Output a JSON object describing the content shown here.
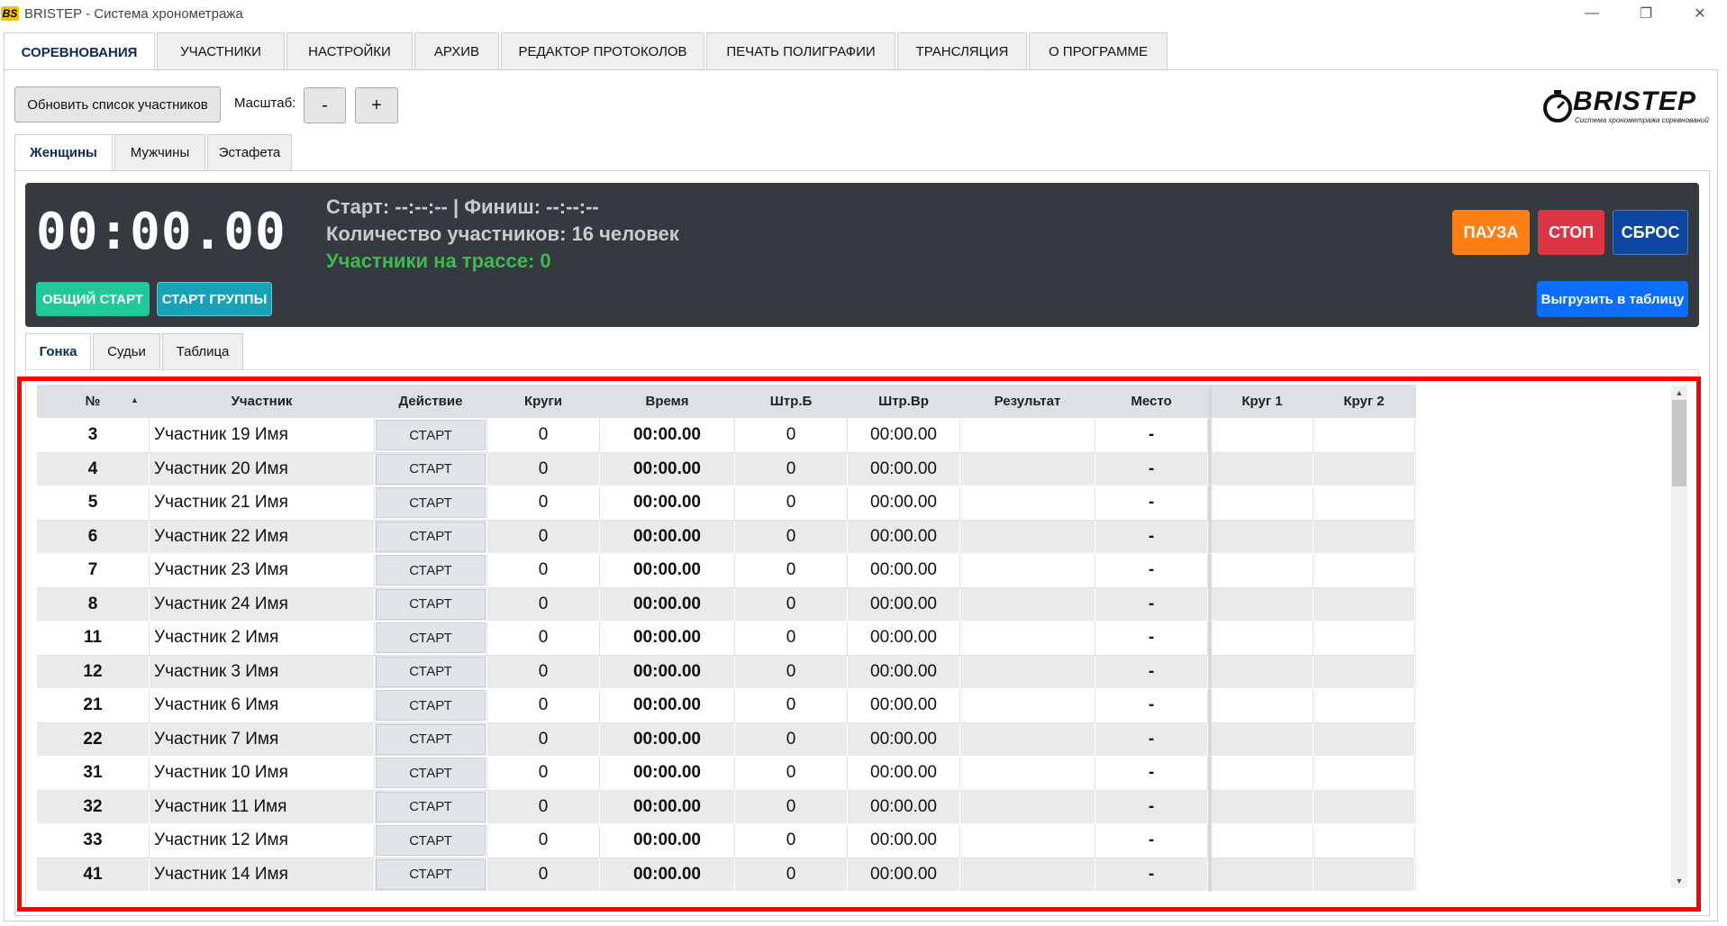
{
  "window": {
    "icon_text": "BS",
    "title": "BRISTEP - Система хронометража"
  },
  "top_tabs": [
    {
      "label": "СОРЕВНОВАНИЯ",
      "active": true
    },
    {
      "label": "УЧАСТНИКИ",
      "active": false
    },
    {
      "label": "НАСТРОЙКИ",
      "active": false
    },
    {
      "label": "АРХИВ",
      "active": false
    },
    {
      "label": "РЕДАКТОР ПРОТОКОЛОВ",
      "active": false
    },
    {
      "label": "ПЕЧАТЬ ПОЛИГРАФИИ",
      "active": false
    },
    {
      "label": "ТРАНСЛЯЦИЯ",
      "active": false
    },
    {
      "label": "О ПРОГРАММЕ",
      "active": false
    }
  ],
  "toolbar": {
    "refresh_label": "Обновить список участников",
    "scale_label": "Масштаб:",
    "minus_label": "-",
    "plus_label": "+"
  },
  "logo": {
    "text": "BRISTEP",
    "subtitle": "Система хронометража соревнований"
  },
  "group_tabs": [
    {
      "label": "Женщины",
      "active": true
    },
    {
      "label": "Мужчины",
      "active": false
    },
    {
      "label": "Эстафета",
      "active": false
    }
  ],
  "timer_panel": {
    "time": "00:00.00",
    "start_finish": "Старт: --:--:-- | Финиш: --:--:--",
    "participants_count": "Количество участников: 16 человек",
    "on_track": "Участники на трассе: 0",
    "general_start_label": "ОБЩИЙ СТАРТ",
    "group_start_label": "СТАРТ ГРУППЫ",
    "pause_label": "ПАУЗА",
    "stop_label": "СТОП",
    "reset_label": "СБРОС",
    "export_label": "Выгрузить в таблицу",
    "colors": {
      "panel": "#343a40",
      "general_start": "#20c997",
      "group_start": "#17a2b8",
      "pause": "#fd7e14",
      "stop": "#dc3545",
      "reset": "#0d47a1",
      "export": "#0d6efd",
      "on_track_text": "#3fb950"
    }
  },
  "race_tabs": [
    {
      "label": "Гонка",
      "active": true
    },
    {
      "label": "Судьи",
      "active": false
    },
    {
      "label": "Таблица",
      "active": false
    }
  ],
  "grid": {
    "sort_indicator": "▲",
    "columns": [
      "№",
      "Участник",
      "Действие",
      "Круги",
      "Время",
      "Штр.Б",
      "Штр.Вр",
      "Результат",
      "Место",
      "Круг 1",
      "Круг 2"
    ],
    "rows": [
      {
        "num": "3",
        "name": "Участник 19 Имя",
        "action": "СТАРТ",
        "laps": "0",
        "time": "00:00.00",
        "penalty": "0",
        "penalty_time": "00:00.00",
        "result": "",
        "place": "-",
        "lap1": "",
        "lap2": ""
      },
      {
        "num": "4",
        "name": "Участник 20 Имя",
        "action": "СТАРТ",
        "laps": "0",
        "time": "00:00.00",
        "penalty": "0",
        "penalty_time": "00:00.00",
        "result": "",
        "place": "-",
        "lap1": "",
        "lap2": ""
      },
      {
        "num": "5",
        "name": "Участник 21 Имя",
        "action": "СТАРТ",
        "laps": "0",
        "time": "00:00.00",
        "penalty": "0",
        "penalty_time": "00:00.00",
        "result": "",
        "place": "-",
        "lap1": "",
        "lap2": ""
      },
      {
        "num": "6",
        "name": "Участник 22 Имя",
        "action": "СТАРТ",
        "laps": "0",
        "time": "00:00.00",
        "penalty": "0",
        "penalty_time": "00:00.00",
        "result": "",
        "place": "-",
        "lap1": "",
        "lap2": ""
      },
      {
        "num": "7",
        "name": "Участник 23 Имя",
        "action": "СТАРТ",
        "laps": "0",
        "time": "00:00.00",
        "penalty": "0",
        "penalty_time": "00:00.00",
        "result": "",
        "place": "-",
        "lap1": "",
        "lap2": ""
      },
      {
        "num": "8",
        "name": "Участник 24 Имя",
        "action": "СТАРТ",
        "laps": "0",
        "time": "00:00.00",
        "penalty": "0",
        "penalty_time": "00:00.00",
        "result": "",
        "place": "-",
        "lap1": "",
        "lap2": ""
      },
      {
        "num": "11",
        "name": "Участник 2 Имя",
        "action": "СТАРТ",
        "laps": "0",
        "time": "00:00.00",
        "penalty": "0",
        "penalty_time": "00:00.00",
        "result": "",
        "place": "-",
        "lap1": "",
        "lap2": ""
      },
      {
        "num": "12",
        "name": "Участник 3 Имя",
        "action": "СТАРТ",
        "laps": "0",
        "time": "00:00.00",
        "penalty": "0",
        "penalty_time": "00:00.00",
        "result": "",
        "place": "-",
        "lap1": "",
        "lap2": ""
      },
      {
        "num": "21",
        "name": "Участник 6 Имя",
        "action": "СТАРТ",
        "laps": "0",
        "time": "00:00.00",
        "penalty": "0",
        "penalty_time": "00:00.00",
        "result": "",
        "place": "-",
        "lap1": "",
        "lap2": ""
      },
      {
        "num": "22",
        "name": "Участник 7 Имя",
        "action": "СТАРТ",
        "laps": "0",
        "time": "00:00.00",
        "penalty": "0",
        "penalty_time": "00:00.00",
        "result": "",
        "place": "-",
        "lap1": "",
        "lap2": ""
      },
      {
        "num": "31",
        "name": "Участник 10 Имя",
        "action": "СТАРТ",
        "laps": "0",
        "time": "00:00.00",
        "penalty": "0",
        "penalty_time": "00:00.00",
        "result": "",
        "place": "-",
        "lap1": "",
        "lap2": ""
      },
      {
        "num": "32",
        "name": "Участник 11 Имя",
        "action": "СТАРТ",
        "laps": "0",
        "time": "00:00.00",
        "penalty": "0",
        "penalty_time": "00:00.00",
        "result": "",
        "place": "-",
        "lap1": "",
        "lap2": ""
      },
      {
        "num": "33",
        "name": "Участник 12 Имя",
        "action": "СТАРТ",
        "laps": "0",
        "time": "00:00.00",
        "penalty": "0",
        "penalty_time": "00:00.00",
        "result": "",
        "place": "-",
        "lap1": "",
        "lap2": ""
      },
      {
        "num": "41",
        "name": "Участник 14 Имя",
        "action": "СТАРТ",
        "laps": "0",
        "time": "00:00.00",
        "penalty": "0",
        "penalty_time": "00:00.00",
        "result": "",
        "place": "-",
        "lap1": "",
        "lap2": ""
      }
    ]
  },
  "highlight_color": "#ff0000"
}
